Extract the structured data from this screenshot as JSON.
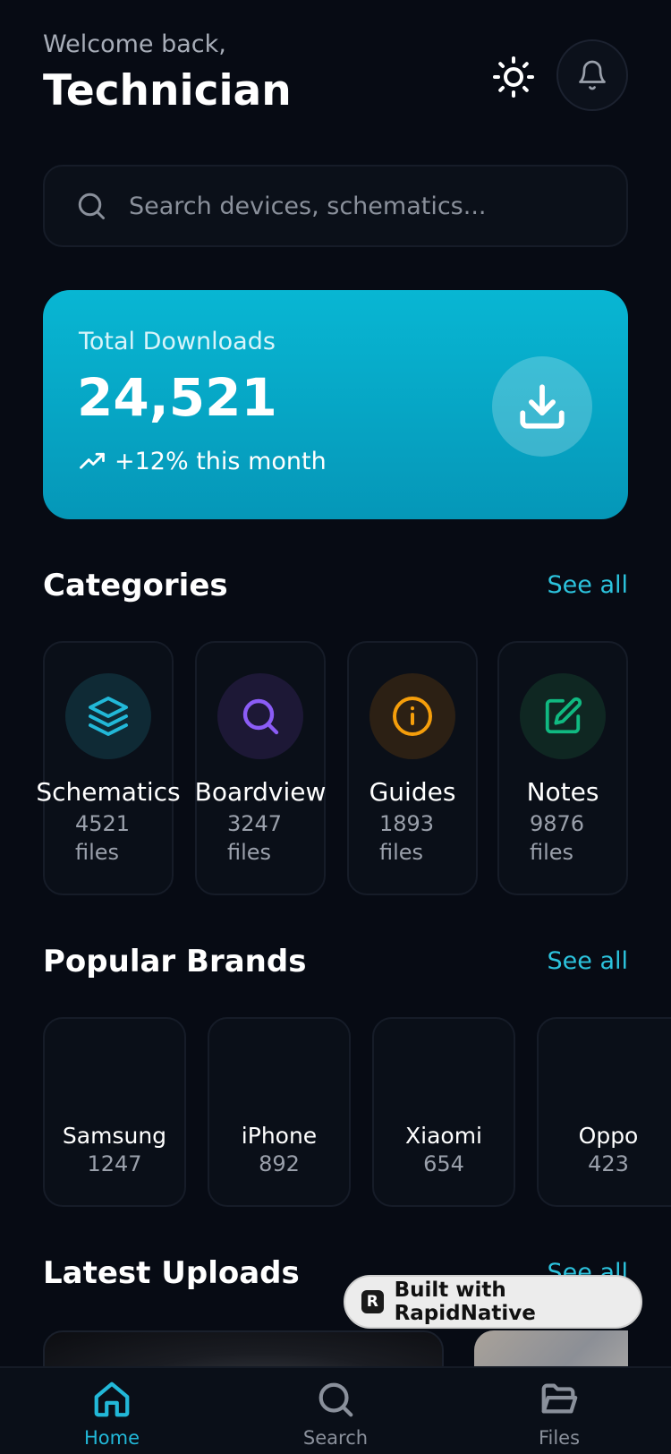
{
  "header": {
    "greeting": "Welcome back,",
    "user_name": "Technician",
    "theme_icon": "sun-icon",
    "notification_icon": "bell-icon"
  },
  "search": {
    "placeholder": "Search devices, schematics...",
    "icon": "search-icon"
  },
  "downloads_card": {
    "label": "Total Downloads",
    "value": "24,521",
    "trend": "+12% this month",
    "trend_icon": "trending-up-icon",
    "action_icon": "download-icon",
    "gradient_colors": [
      "#08b6d3",
      "#0597b8"
    ]
  },
  "categories": {
    "title": "Categories",
    "see_all": "See all",
    "items": [
      {
        "name": "Schematics",
        "count": "4521",
        "unit": "files",
        "icon": "layers-icon",
        "color": "#22b8d8"
      },
      {
        "name": "Boardview",
        "count": "3247",
        "unit": "files",
        "icon": "search-icon",
        "color": "#8b5cf6"
      },
      {
        "name": "Guides",
        "count": "1893",
        "unit": "files",
        "icon": "info-icon",
        "color": "#f59e0b"
      },
      {
        "name": "Notes",
        "count": "9876",
        "unit": "files",
        "icon": "edit-icon",
        "color": "#10b981"
      }
    ]
  },
  "brands": {
    "title": "Popular Brands",
    "see_all": "See all",
    "items": [
      {
        "name": "Samsung",
        "count": "1247"
      },
      {
        "name": "iPhone",
        "count": "892"
      },
      {
        "name": "Xiaomi",
        "count": "654"
      },
      {
        "name": "Oppo",
        "count": "423"
      }
    ]
  },
  "latest_uploads": {
    "title": "Latest Uploads",
    "see_all": "See all"
  },
  "badge": {
    "text": "Built with RapidNative",
    "logo": "R"
  },
  "bottom_nav": {
    "items": [
      {
        "label": "Home",
        "icon": "home-icon",
        "active": true
      },
      {
        "label": "Search",
        "icon": "search-icon",
        "active": false
      },
      {
        "label": "Files",
        "icon": "folder-icon",
        "active": false
      }
    ]
  },
  "colors": {
    "accent": "#2cc3dd",
    "background": "#070b14",
    "muted": "#9aa0ab"
  }
}
